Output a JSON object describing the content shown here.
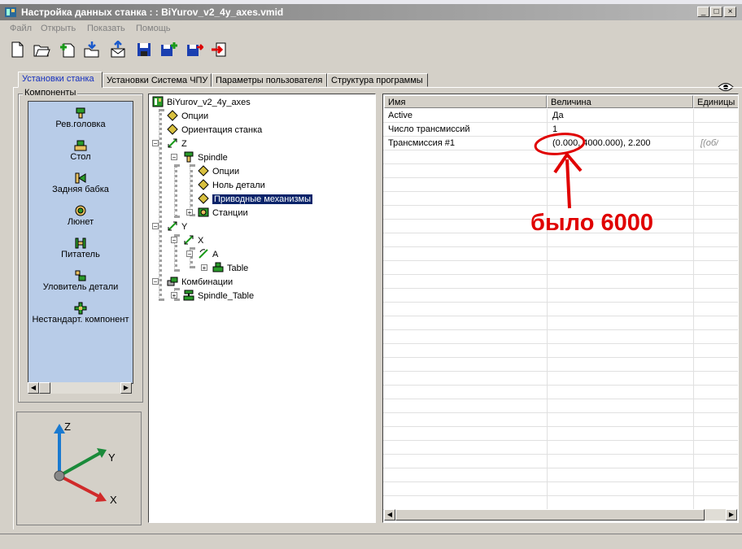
{
  "window": {
    "title": "Настройка данных станка : : BiYurov_v2_4y_axes.vmid",
    "buttons": {
      "minimize": "_",
      "maximize": "□",
      "close": "×"
    }
  },
  "menu": [
    "Файл",
    "Открыть",
    "Показать",
    "Помощь"
  ],
  "toolbar": {
    "icons": [
      "new-file-icon",
      "open-folder-icon",
      "add-icon",
      "import-icon",
      "export-icon",
      "save-icon",
      "save-as-icon",
      "save-alt-icon",
      "exit-icon"
    ],
    "view_icon": "eye-icon"
  },
  "tabs": [
    "Установки станка",
    "Установки Система ЧПУ",
    "Параметры пользователя",
    "Структура программы"
  ],
  "components": {
    "label": "Компоненты",
    "items": [
      "Рев.головка",
      "Стол",
      "Задняя бабка",
      "Люнет",
      "Питатель",
      "Уловитель детали",
      "Нестандарт. компонент"
    ]
  },
  "axes_preview": {
    "labels": [
      "Z",
      "Y",
      "X"
    ]
  },
  "tree": {
    "root": "BiYurov_v2_4y_axes",
    "nodes": [
      "Опции",
      "Ориентация станка",
      "Z",
      "Spindle",
      "Опции",
      "Ноль детали",
      "Приводные механизмы",
      "Станции",
      "Y",
      "X",
      "A",
      "Table",
      "Комбинации",
      "Spindle_Table"
    ]
  },
  "grid": {
    "columns": [
      "Имя",
      "Величина",
      "Единицы"
    ],
    "rows": [
      {
        "name": "Active",
        "value": "Да",
        "unit": ""
      },
      {
        "name": "Число трансмиссий",
        "value": "1",
        "unit": ""
      },
      {
        "name": "Трансмиссия #1",
        "value": "(0.000, 4000.000), 2.200",
        "unit": "[(об/"
      }
    ]
  },
  "annotation": {
    "text": "было 6000",
    "color": "#e00000"
  },
  "colors": {
    "selection": "#0a246a",
    "component_list_bg": "#b8cce8",
    "tab_active": "#1530c0"
  }
}
